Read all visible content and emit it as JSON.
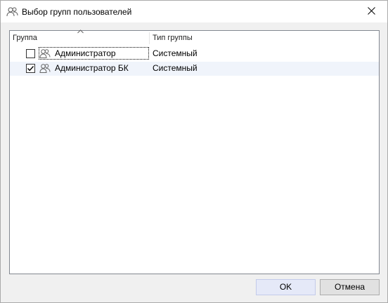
{
  "window": {
    "title": "Выбор групп пользователей",
    "title_icon": "users-icon",
    "close_icon": "close-icon"
  },
  "list": {
    "columns": [
      "Группа",
      "Тип группы"
    ],
    "sort_column": "Группа",
    "sort_direction": "ascending",
    "rows": [
      {
        "checked": false,
        "icon": "user-group-icon",
        "name": "Администратор",
        "type": "Системный"
      },
      {
        "checked": true,
        "icon": "user-group-icon",
        "name": "Администратор БК",
        "type": "Системный"
      }
    ]
  },
  "buttons": {
    "ok": "OK",
    "cancel": "Отмена"
  },
  "colors": {
    "accent": "#c3cbea",
    "selected_row": "#f0f4fb"
  }
}
